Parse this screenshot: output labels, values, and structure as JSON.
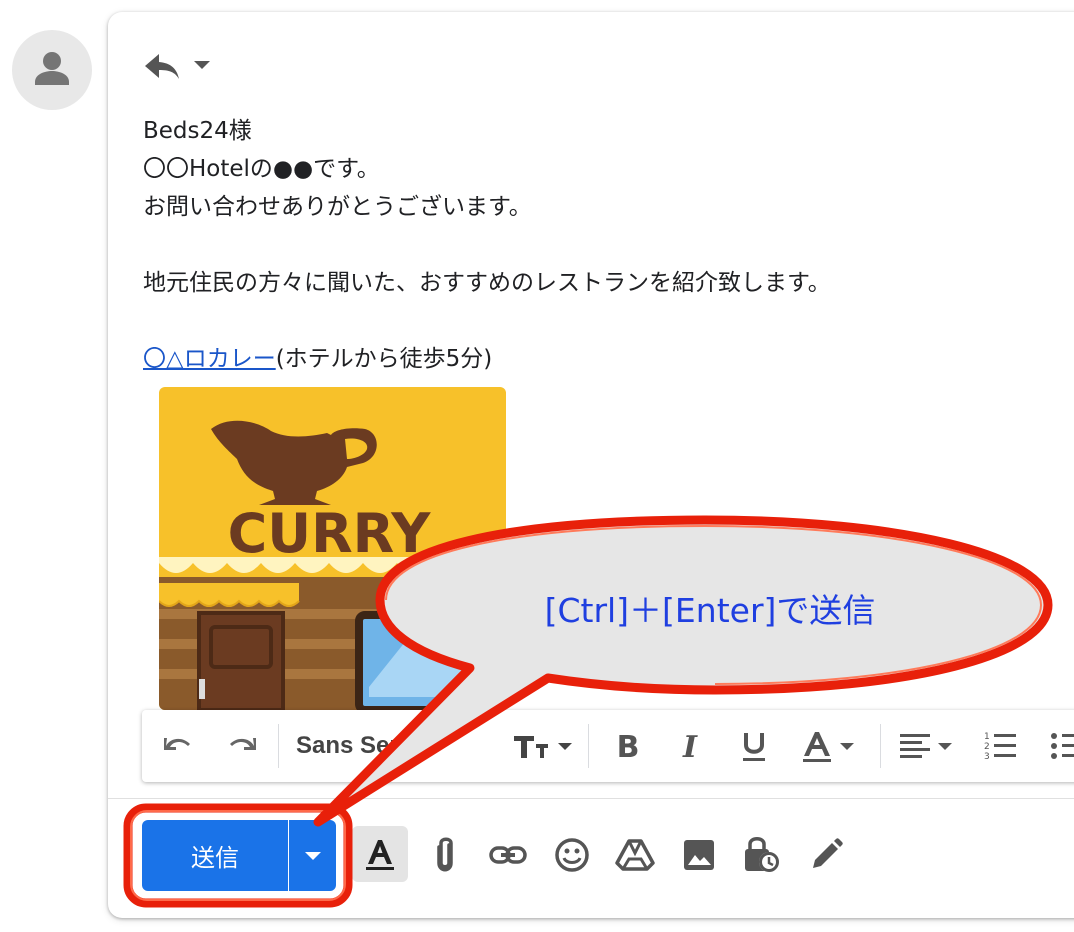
{
  "email": {
    "lines": [
      "Beds24様",
      "〇〇Hotelの●●です。",
      "お問い合わせありがとうございます。",
      "",
      "地元住民の方々に聞いた、おすすめのレストランを紹介致します。",
      ""
    ],
    "restaurant_link": "〇△ロカレー",
    "restaurant_note": "(ホテルから徒歩5分)",
    "image_sign_text": "CURRY"
  },
  "format_toolbar": {
    "font_name": "Sans Serif"
  },
  "send": {
    "label": "送信"
  },
  "callout": {
    "text": "[Ctrl]＋[Enter]で送信"
  },
  "colors": {
    "send_button": "#1a73e8",
    "link": "#1a56c9",
    "callout_text": "#1f3fe0",
    "callout_border": "#e8200a"
  }
}
